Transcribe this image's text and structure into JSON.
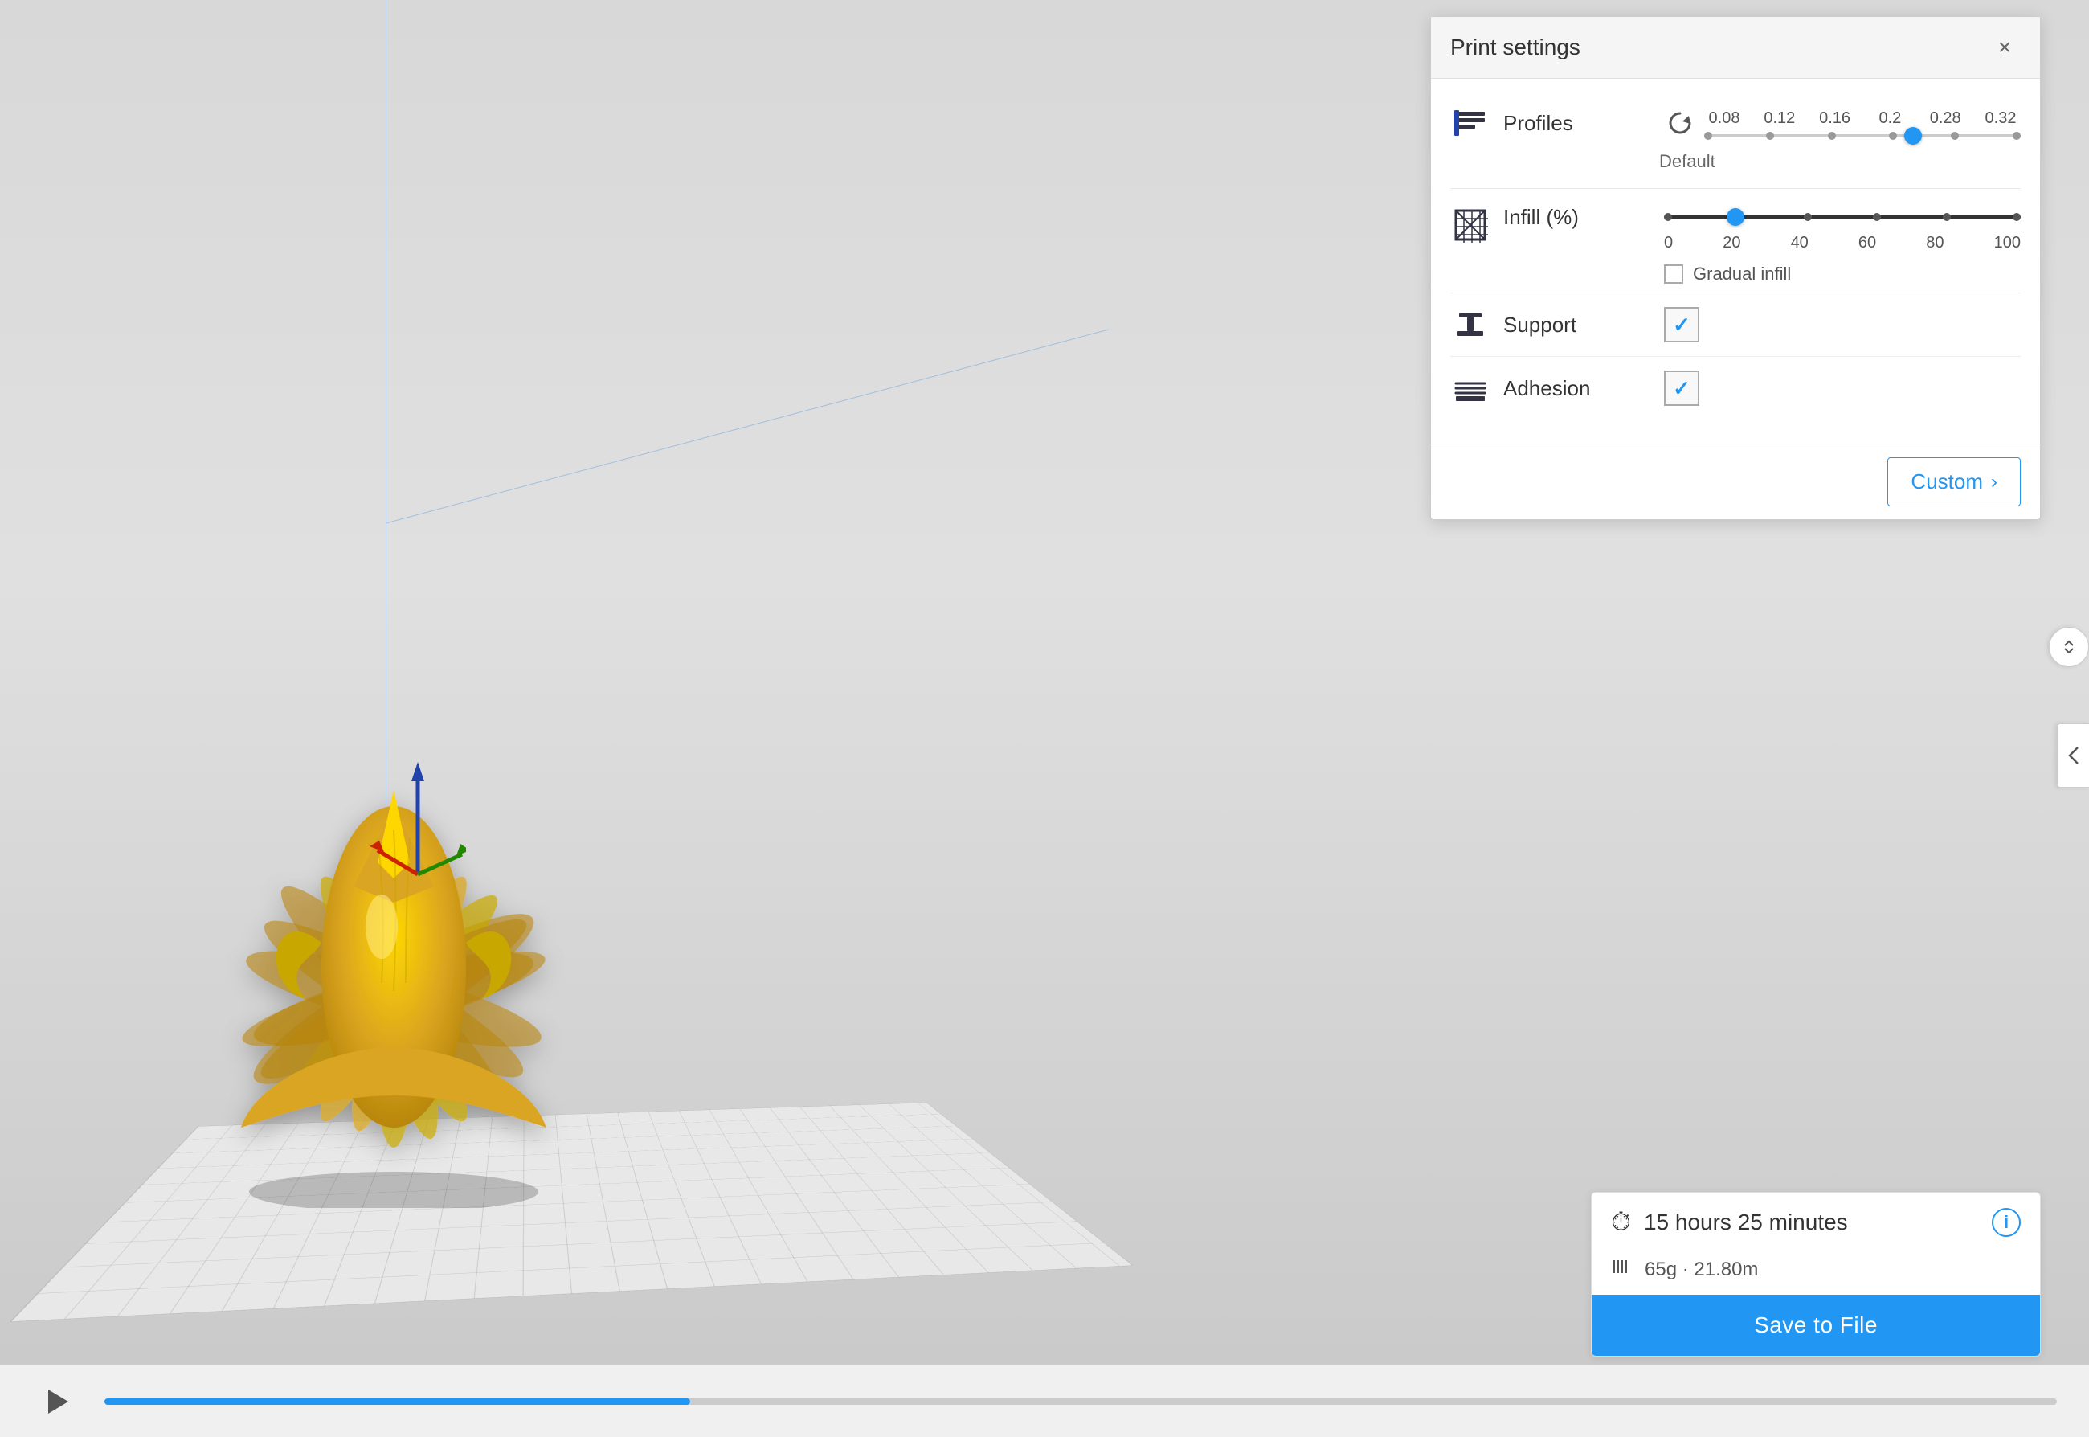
{
  "viewport": {
    "background": "#d8d8d8"
  },
  "panel": {
    "title": "Print settings",
    "close_label": "×"
  },
  "profiles": {
    "label": "Profiles",
    "reset_icon": "↺",
    "ticks": [
      "0.08",
      "0.12",
      "0.16",
      "0.2",
      "0.28",
      "0.32"
    ],
    "thumb_position": "66%",
    "default_label": "Default"
  },
  "infill": {
    "label": "Infill (%)",
    "thumb_position": "20%",
    "labels": [
      "0",
      "20",
      "40",
      "60",
      "80",
      "100"
    ],
    "gradual_label": "Gradual infill"
  },
  "support": {
    "label": "Support",
    "checked": true,
    "check_mark": "✓"
  },
  "adhesion": {
    "label": "Adhesion",
    "checked": true,
    "check_mark": "✓"
  },
  "custom_button": {
    "label": "Custom",
    "arrow": "›"
  },
  "bottom_info": {
    "time_label": "15 hours 25 minutes",
    "material_label": "65g · 21.80m",
    "save_button": "Save to File",
    "info_icon": "i",
    "clock_icon": "🕐",
    "filament_icon": "⏸"
  },
  "timeline": {
    "play_icon": "▶"
  }
}
